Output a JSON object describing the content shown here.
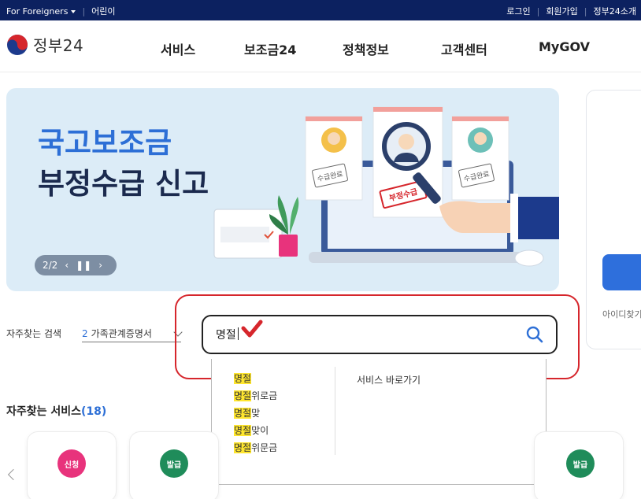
{
  "utility_bar": {
    "foreigners": "For Foreigners",
    "kids": "어린이",
    "login": "로그인",
    "signup": "회원가입",
    "about": "정부24소개"
  },
  "header": {
    "logo_text": "정부24",
    "nav": [
      "서비스",
      "보조금24",
      "정책정보",
      "고객센터",
      "MyGOV"
    ]
  },
  "hero": {
    "title_line1": "국고보조금",
    "title_line2": "부정수급 신고",
    "pager": "2/2",
    "stamp_left": "수급완료",
    "stamp_center": "부정수급",
    "stamp_right": "수급완료"
  },
  "side_card": {
    "id_find": "아이디찾기"
  },
  "search": {
    "freq_label": "자주찾는 검색",
    "freq_select_num": "2",
    "freq_select_text": "가족관계증명서",
    "input_value": "명절",
    "suggest_items": [
      {
        "match": "명절",
        "rest": ""
      },
      {
        "match": "명절",
        "rest": "위로금"
      },
      {
        "match": "명절",
        "rest": "맞"
      },
      {
        "match": "명절",
        "rest": "맞이"
      },
      {
        "match": "명절",
        "rest": "위문금"
      }
    ],
    "goto_label": "서비스 바로가기"
  },
  "services": {
    "title": "자주찾는 서비스",
    "count": "(18)",
    "cards": [
      {
        "badge": "신청",
        "color": "pink"
      },
      {
        "badge": "발급",
        "color": "green"
      },
      {
        "badge": "발급",
        "color": "green"
      }
    ]
  },
  "colors": {
    "utility_bg": "#0c2160",
    "accent_blue": "#2d6fd6",
    "hero_bg": "#dcecf7",
    "highlight": "#ffe62e",
    "annotation_red": "#d6262c"
  }
}
